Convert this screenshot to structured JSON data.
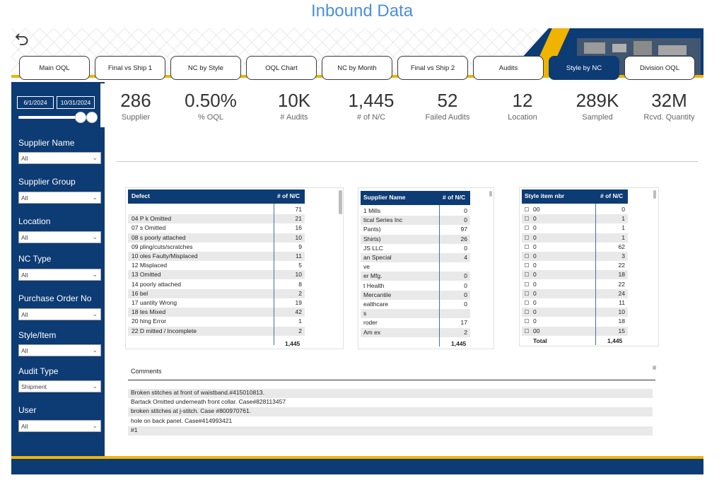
{
  "page_title": "Inbound Data",
  "colors": {
    "navy": "#0d3b74",
    "gold": "#f0b400",
    "title_blue": "#4a90d9"
  },
  "icons": {
    "back": "back-arrow-icon",
    "dropdown": "chevron-down-icon"
  },
  "tabs": [
    {
      "label": "Main OQL"
    },
    {
      "label": "Final vs Ship 1"
    },
    {
      "label": "NC by Style"
    },
    {
      "label": "OQL Chart"
    },
    {
      "label": "NC by Month"
    },
    {
      "label": "Final vs Ship 2"
    },
    {
      "label": "Audits"
    },
    {
      "label": "Style by NC"
    },
    {
      "label": "Division OQL"
    }
  ],
  "active_tab": "Style by NC",
  "date_range": {
    "start": "6/1/2024",
    "end": "10/31/2024"
  },
  "filters": [
    {
      "label": "Supplier Name",
      "value": "All"
    },
    {
      "label": "Supplier Group",
      "value": "All"
    },
    {
      "label": "Location",
      "value": "All"
    },
    {
      "label": "NC Type",
      "value": "All"
    },
    {
      "label": "Purchase Order No",
      "value": "All"
    },
    {
      "label": "Style/Item",
      "value": "All"
    },
    {
      "label": "Audit Type",
      "value": "Shipment"
    },
    {
      "label": "User",
      "value": "All"
    }
  ],
  "kpis": [
    {
      "value": "286",
      "label": "Supplier"
    },
    {
      "value": "0.50%",
      "label": "% OQL"
    },
    {
      "value": "10K",
      "label": "# Audits"
    },
    {
      "value": "1,445",
      "label": "# of N/C"
    },
    {
      "value": "52",
      "label": "Failed Audits"
    },
    {
      "value": "12",
      "label": "Location"
    },
    {
      "value": "289K",
      "label": "Sampled"
    },
    {
      "value": "32M",
      "label": "Rcvd. Quantity"
    }
  ],
  "defect_table": {
    "headers": [
      "Defect",
      "# of N/C"
    ],
    "rows": [
      [
        "",
        "71"
      ],
      [
        "04 P    k Omitted",
        "21"
      ],
      [
        "07        s Omitted",
        "16"
      ],
      [
        "08        s poorly attached",
        "10"
      ],
      [
        "09        pling/cuts/scratches",
        "9"
      ],
      [
        "10        oles Faulty/Misplaced",
        "11"
      ],
      [
        "12        Misplaced",
        "5"
      ],
      [
        "13        Omitted",
        "10"
      ],
      [
        "14        poorly attached",
        "8"
      ],
      [
        "16        bel",
        "2"
      ],
      [
        "17        uantity Wrong",
        "19"
      ],
      [
        "18        tes Mixed",
        "42"
      ],
      [
        "20        hing Error",
        "1"
      ],
      [
        "22 D    mitted / Incomplete",
        "2"
      ]
    ],
    "total": "1,445"
  },
  "supplier_table": {
    "headers": [
      "Supplier Name",
      "# of N/C"
    ],
    "rows": [
      [
        "1      Mills",
        "0"
      ],
      [
        "       tical Series Inc",
        "0"
      ],
      [
        "       Pants)",
        "97"
      ],
      [
        "       Shirts)",
        "26"
      ],
      [
        "       JS LLC",
        "0"
      ],
      [
        "       an Special",
        "4"
      ],
      [
        "       ve",
        ""
      ],
      [
        "       er Mfg.",
        "0"
      ],
      [
        "       t Health",
        "0"
      ],
      [
        "       Mercantile",
        "0"
      ],
      [
        "       ealthcare",
        "0"
      ],
      [
        "       s",
        ""
      ],
      [
        "       roder",
        "17"
      ],
      [
        "Am    ex",
        "2"
      ]
    ],
    "total": "1,445"
  },
  "style_table": {
    "headers": [
      "Style item nbr",
      "# of N/C"
    ],
    "rows": [
      [
        "00",
        "0"
      ],
      [
        "0",
        "1"
      ],
      [
        "0",
        "1"
      ],
      [
        "0",
        "1"
      ],
      [
        "0",
        "62"
      ],
      [
        "0",
        "3"
      ],
      [
        "0",
        "22"
      ],
      [
        "0",
        "18"
      ],
      [
        "0",
        "22"
      ],
      [
        "0",
        "24"
      ],
      [
        "0",
        "11"
      ],
      [
        "0",
        "10"
      ],
      [
        "0",
        "18"
      ],
      [
        "00",
        "15"
      ]
    ],
    "total_label": "Total",
    "total": "1,445"
  },
  "comments": {
    "title": "Comments",
    "rows": [
      "Broken stitches at front of waistband.#415010813.",
      "Bartack Omitted underneath front collar. Case#828113457",
      "broken stitches at j-stitch. Case #800970761.",
      "hole on back panel. Case#414993421",
      "#1"
    ]
  }
}
